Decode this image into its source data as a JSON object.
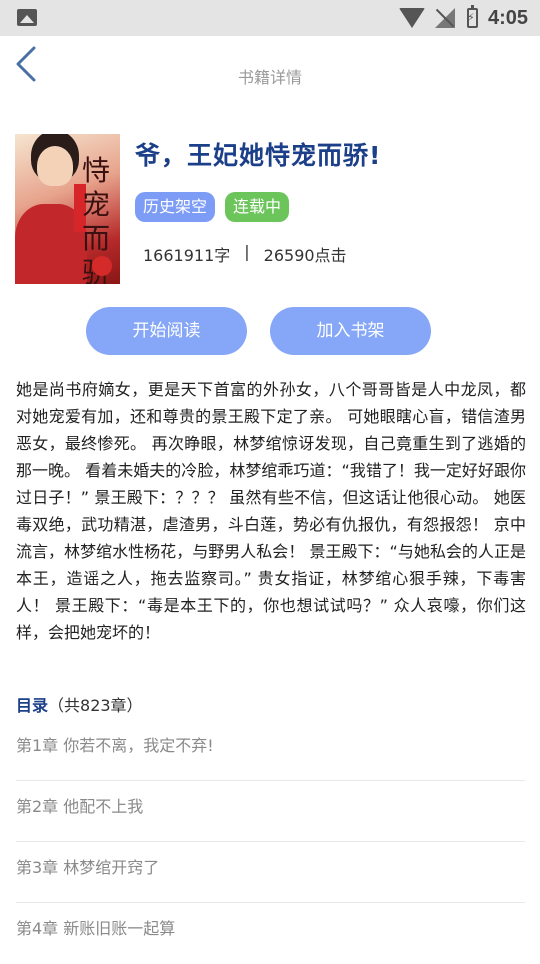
{
  "status_bar": {
    "time": "4:05"
  },
  "header": {
    "title": "书籍详情"
  },
  "book": {
    "title": "爷，王妃她恃宠而骄!",
    "cover_text": "恃宠而骄",
    "tags": [
      "历史架空",
      "连载中"
    ],
    "word_count": "1661911字",
    "separator": "|",
    "click_count": "26590点击"
  },
  "actions": {
    "read_label": "开始阅读",
    "shelf_label": "加入书架"
  },
  "description": "她是尚书府嫡女，更是天下首富的外孙女，八个哥哥皆是人中龙凤，都对她宠爱有加，还和尊贵的景王殿下定了亲。 可她眼瞎心盲，错信渣男恶女，最终惨死。 再次睁眼，林梦绾惊讶发现，自己竟重生到了逃婚的那一晚。 看着未婚夫的冷脸，林梦绾乖巧道：“我错了！我一定好好跟你过日子！” 景王殿下：？？？ 虽然有些不信，但这话让他很心动。 她医毒双绝，武功精湛，虐渣男，斗白莲，势必有仇报仇，有怨报怨！ 京中流言，林梦绾水性杨花，与野男人私会！ 景王殿下：“与她私会的人正是本王，造谣之人，拖去监察司。” 贵女指证，林梦绾心狠手辣，下毒害人！ 景王殿下：“毒是本王下的，你也想试试吗？” 众人哀嚎，你们这样，会把她宠坏的！",
  "toc": {
    "label": "目录",
    "count": "（共823章）",
    "chapters": [
      "第1章 你若不离，我定不弃!",
      "第2章 他配不上我",
      "第3章 林梦绾开窍了",
      "第4章 新账旧账一起算"
    ]
  }
}
